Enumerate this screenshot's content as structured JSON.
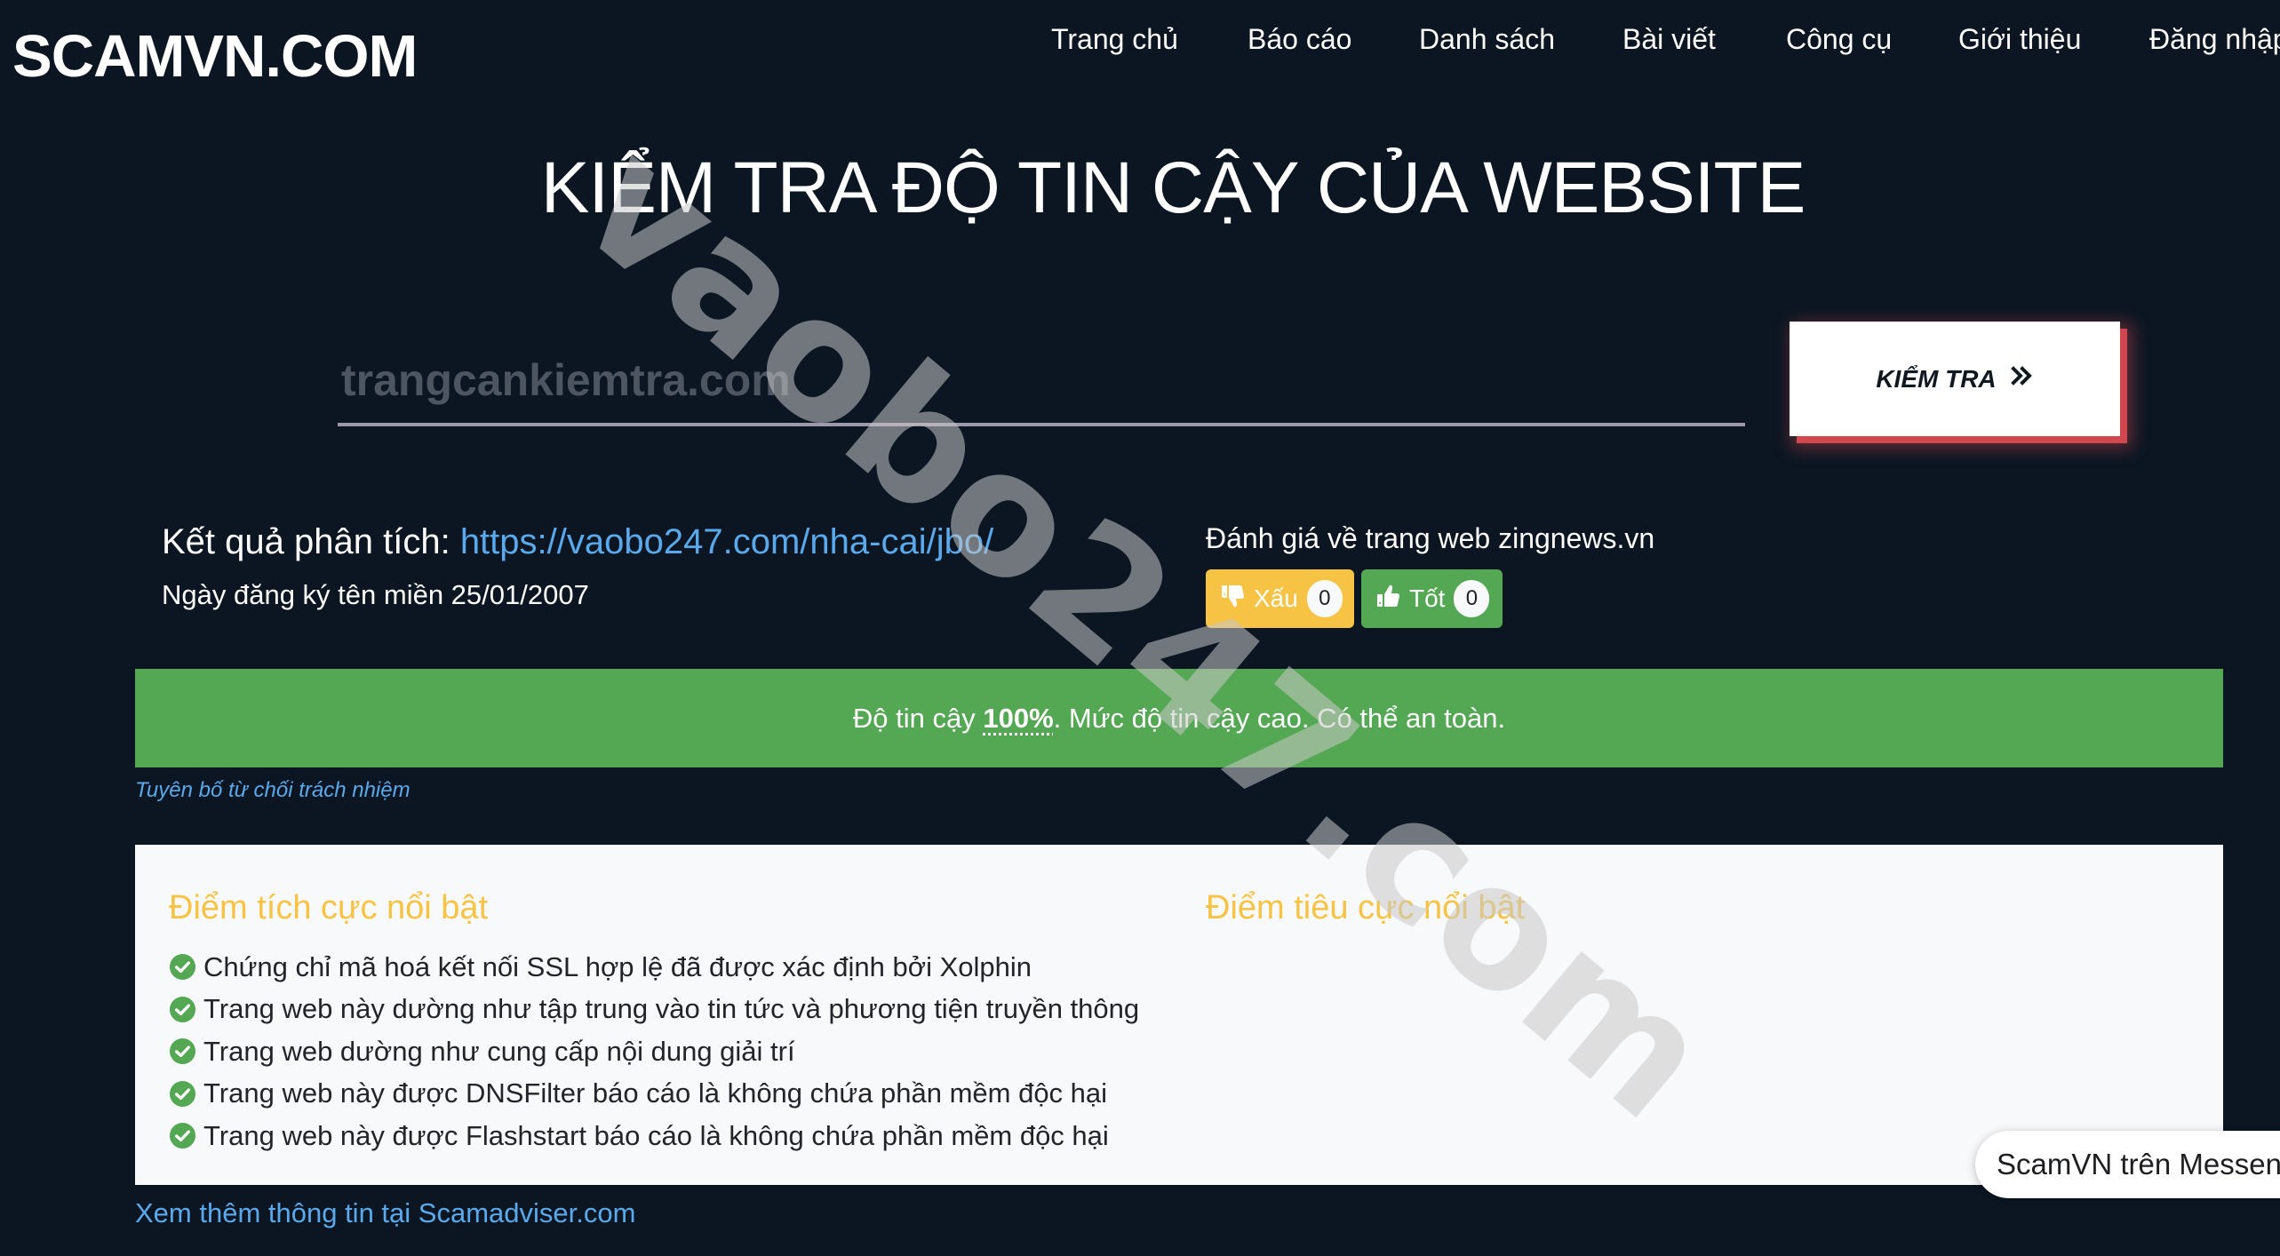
{
  "header": {
    "logo": "SCAMVN.COM",
    "nav": [
      {
        "label": "Trang chủ"
      },
      {
        "label": "Báo cáo"
      },
      {
        "label": "Danh sách"
      },
      {
        "label": "Bài viết"
      },
      {
        "label": "Công cụ"
      },
      {
        "label": "Giới thiệu"
      },
      {
        "label": "Đăng nhập"
      }
    ]
  },
  "page_title": "KIỂM TRA ĐỘ TIN CẬY CỦA WEBSITE",
  "search": {
    "placeholder": "trangcankiemtra.com",
    "value": "",
    "button_label": "KIỂM TRA",
    "button_icon": "double-chevron-right-icon"
  },
  "result": {
    "label": "Kết quả phân tích:",
    "url": "https://vaobo247.com/nha-cai/jbo/",
    "registration_date": "Ngày đăng ký tên miền 25/01/2007"
  },
  "review": {
    "title": "Đánh giá về trang web zingnews.vn",
    "bad_label": "Xấu",
    "bad_count": "0",
    "good_label": "Tốt",
    "good_count": "0",
    "colors": {
      "bad": "#f6c344",
      "good": "#54a753"
    }
  },
  "trust": {
    "prefix": "Độ tin cậy",
    "percent": "100%",
    "suffix": ". Mức độ tin cậy cao. Có thể an toàn.",
    "trust_value": 100,
    "color": "#54a753"
  },
  "disclaimer": "Tuyên bố từ chối trách nhiệm",
  "highlights": {
    "positive_title": "Điểm tích cực nổi bật",
    "negative_title": "Điểm tiêu cực nổi bật",
    "positive": [
      "Chứng chỉ mã hoá kết nối SSL hợp lệ đã được xác định bởi Xolphin",
      "Trang web này dường như tập trung vào tin tức và phương tiện truyền thông",
      "Trang web dường như cung cấp nội dung giải trí",
      "Trang web này được DNSFilter báo cáo là không chứa phần mềm độc hại",
      "Trang web này được Flashstart báo cáo là không chứa phần mềm độc hại"
    ],
    "negative": []
  },
  "more_info": "Xem thêm thông tin tại Scamadviser.com",
  "messenger": "ScamVN trên Messenger",
  "watermark": "vaobo247.com"
}
